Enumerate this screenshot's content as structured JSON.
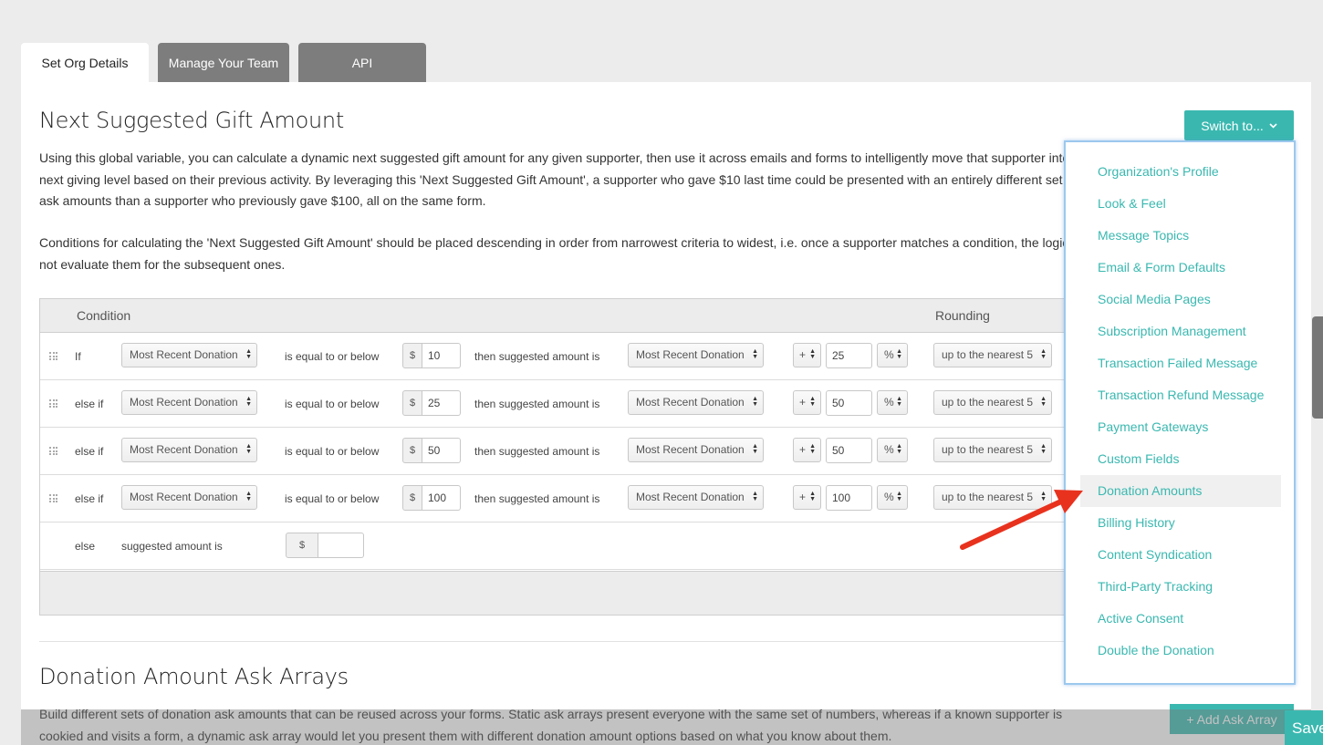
{
  "tabs": [
    "Set Org Details",
    "Manage Your Team",
    "API"
  ],
  "gift": {
    "title": "Next Suggested Gift Amount",
    "para1": "Using this global variable, you can calculate a dynamic next suggested gift amount for any given supporter, then use it across emails and forms to intelligently move that supporter into the next giving level based on their previous activity. By leveraging this 'Next Suggested Gift Amount', a supporter who gave $10 last time could be presented with an entirely different set of ask amounts than a supporter who previously gave $100, all on the same form.",
    "para2": "Conditions for calculating the 'Next Suggested Gift Amount' should be placed descending in order from narrowest criteria to widest, i.e. once a supporter matches a condition, the logic will not evaluate them for the subsequent ones."
  },
  "switch_label": "Switch to...",
  "table": {
    "headers": {
      "condition": "Condition",
      "rounding": "Rounding"
    },
    "comparison": "is equal to or below",
    "then_text": "then suggested amount is",
    "currency": "$",
    "rows": [
      {
        "prefix": "If",
        "field": "Most Recent Donation",
        "threshold": "10",
        "base": "Most Recent Donation",
        "op": "+",
        "amount": "25",
        "unit": "%",
        "rounding": "up to the nearest 5"
      },
      {
        "prefix": "else if",
        "field": "Most Recent Donation",
        "threshold": "25",
        "base": "Most Recent Donation",
        "op": "+",
        "amount": "50",
        "unit": "%",
        "rounding": "up to the nearest 5"
      },
      {
        "prefix": "else if",
        "field": "Most Recent Donation",
        "threshold": "50",
        "base": "Most Recent Donation",
        "op": "+",
        "amount": "50",
        "unit": "%",
        "rounding": "up to the nearest 5"
      },
      {
        "prefix": "else if",
        "field": "Most Recent Donation",
        "threshold": "100",
        "base": "Most Recent Donation",
        "op": "+",
        "amount": "100",
        "unit": "%",
        "rounding": "up to the nearest 5"
      }
    ],
    "else_row": {
      "prefix": "else",
      "label": "suggested amount is",
      "currency": "$",
      "value": ""
    }
  },
  "ask": {
    "title": "Donation Amount Ask Arrays",
    "para": "Build different sets of donation ask amounts that can be reused across your forms. Static ask arrays present everyone with the same set of numbers, whereas if a known supporter is cookied and visits a form, a dynamic ask array would let you present them with different donation amount options based on what you know about them.",
    "add_button": "+ Add Ask Array"
  },
  "save_label": "Save",
  "dropdown": {
    "items": [
      "Organization's Profile",
      "Look & Feel",
      "Message Topics",
      "Email & Form Defaults",
      "Social Media Pages",
      "Subscription Management",
      "Transaction Failed Message",
      "Transaction Refund Message",
      "Payment Gateways",
      "Custom Fields",
      "Donation Amounts",
      "Billing History",
      "Content Syndication",
      "Third-Party Tracking",
      "Active Consent",
      "Double the Donation"
    ],
    "highlighted": "Donation Amounts"
  },
  "colors": {
    "accent": "#3ab8b0",
    "annotation_arrow": "#e8321e",
    "dropdown_border": "#9cc8ee"
  },
  "icons": {
    "switch_caret": "chevron-down-icon",
    "row_handle": "drag-handle-icon",
    "annotation": "red-arrow-icon"
  }
}
